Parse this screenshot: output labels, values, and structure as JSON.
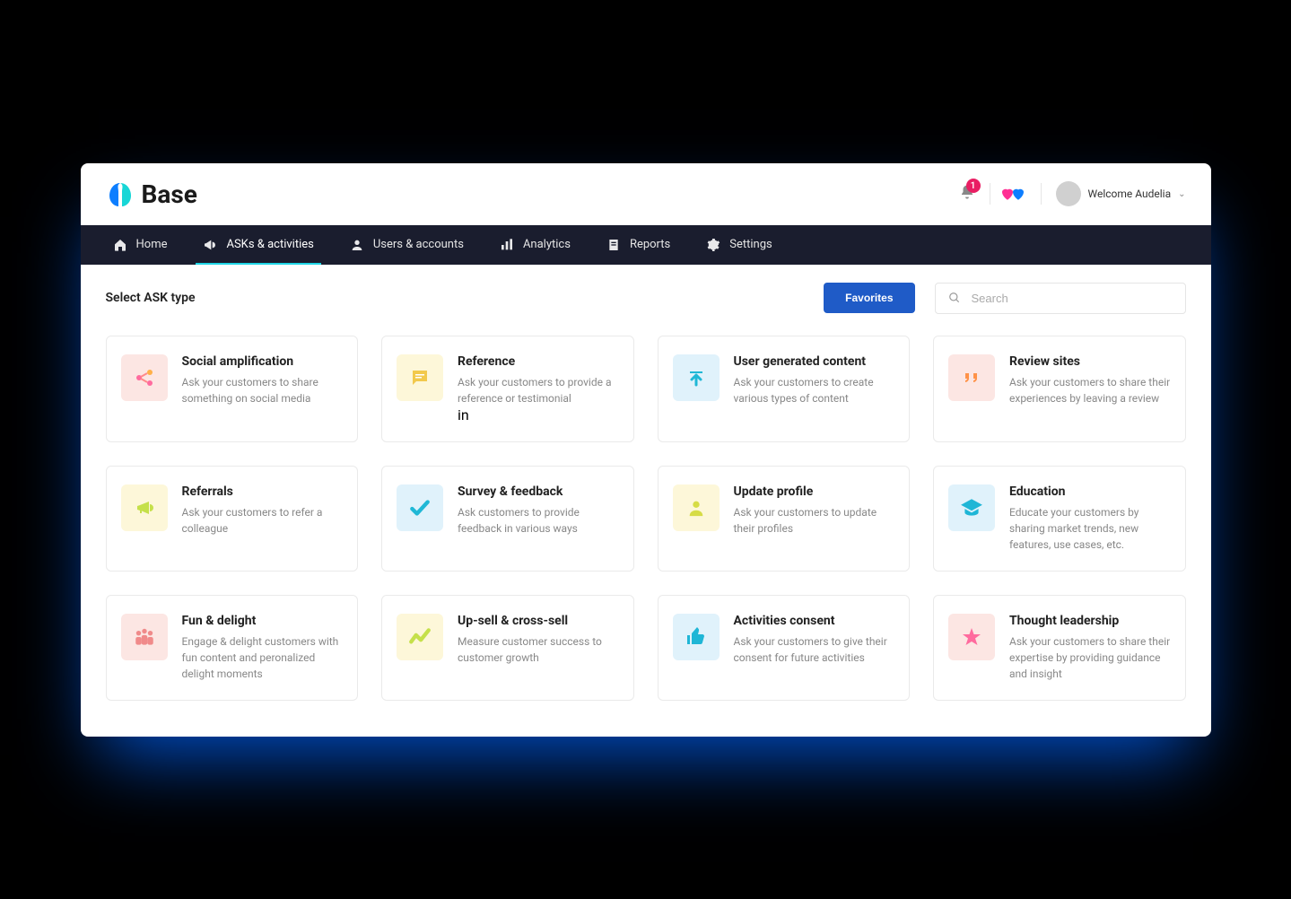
{
  "brand": "Base",
  "notifications": {
    "count": "1"
  },
  "user": {
    "welcome_label": "Welcome Audelia"
  },
  "nav": {
    "items": [
      {
        "label": "Home"
      },
      {
        "label": "ASKs & activities"
      },
      {
        "label": "Users & accounts"
      },
      {
        "label": "Analytics"
      },
      {
        "label": "Reports"
      },
      {
        "label": "Settings"
      }
    ]
  },
  "toolbar": {
    "title": "Select ASK type",
    "favorites_label": "Favorites",
    "search_placeholder": "Search"
  },
  "cards": [
    {
      "title": "Social amplification",
      "desc": "Ask your customers to share something on social media"
    },
    {
      "title": "Reference",
      "desc": "Ask your customers to provide a reference or testimonial"
    },
    {
      "title": "User generated content",
      "desc": "Ask your customers to create various types of content"
    },
    {
      "title": "Review sites",
      "desc": "Ask your customers to share their experiences by leaving a review"
    },
    {
      "title": "Referrals",
      "desc": "Ask your customers to refer a colleague"
    },
    {
      "title": "Survey & feedback",
      "desc": "Ask customers to provide feedback in various ways"
    },
    {
      "title": "Update profile",
      "desc": "Ask your customers to update their profiles"
    },
    {
      "title": "Education",
      "desc": "Educate your customers by sharing market trends, new features, use cases, etc."
    },
    {
      "title": "Fun & delight",
      "desc": "Engage & delight customers with fun content and peronalized delight moments"
    },
    {
      "title": "Up-sell & cross-sell",
      "desc": "Measure customer success to customer growth"
    },
    {
      "title": "Activities consent",
      "desc": "Ask your customers to give their consent for future activities"
    },
    {
      "title": "Thought leadership",
      "desc": "Ask your customers to share their expertise by providing guidance and insight"
    }
  ]
}
